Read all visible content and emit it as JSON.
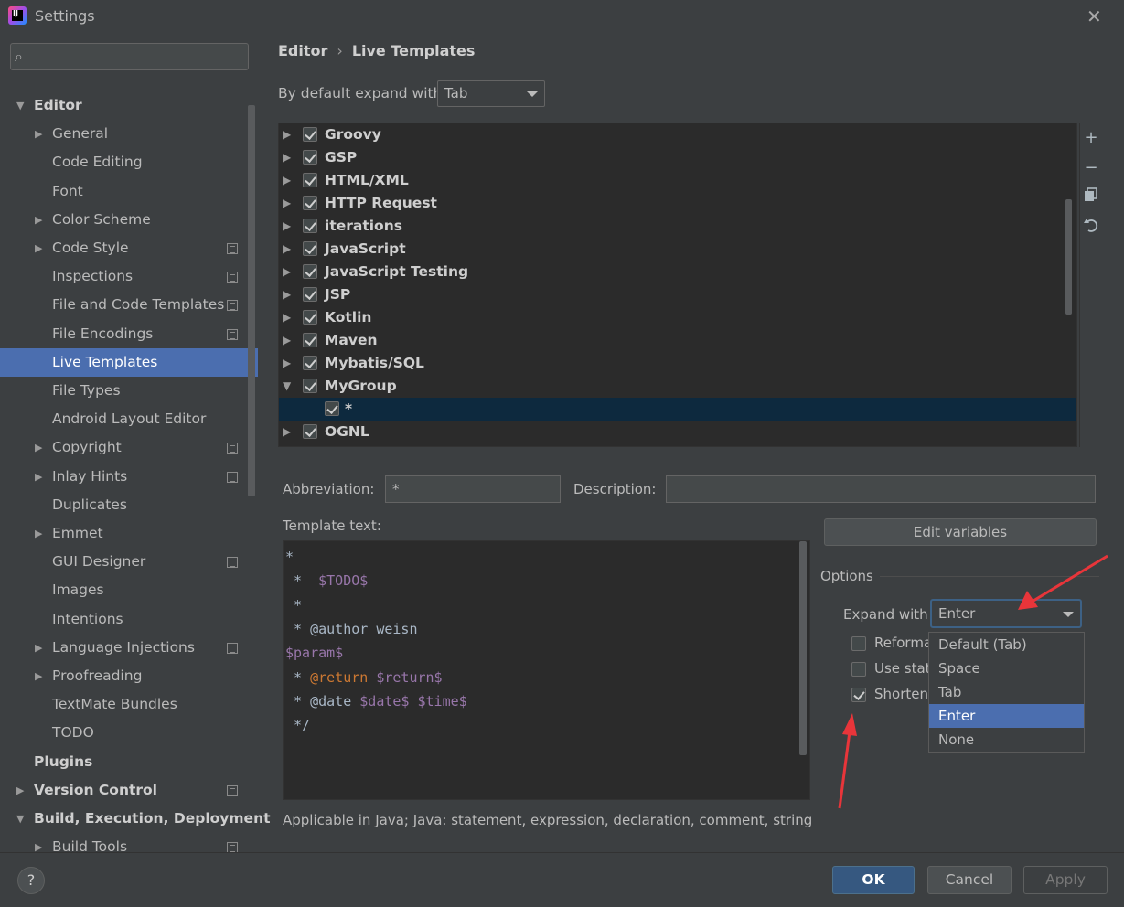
{
  "window": {
    "title": "Settings",
    "close_icon": "close-icon",
    "logo_letters": "IJ"
  },
  "sidebar": {
    "search": {
      "placeholder": "",
      "value": ""
    },
    "items": [
      {
        "label": "Editor",
        "bold": true,
        "expanded": true
      },
      {
        "label": "General",
        "expandable": true
      },
      {
        "label": "Code Editing"
      },
      {
        "label": "Font"
      },
      {
        "label": "Color Scheme",
        "expandable": true
      },
      {
        "label": "Code Style",
        "expandable": true,
        "page_icon": true
      },
      {
        "label": "Inspections",
        "page_icon": true
      },
      {
        "label": "File and Code Templates",
        "page_icon": true
      },
      {
        "label": "File Encodings",
        "page_icon": true
      },
      {
        "label": "Live Templates",
        "selected": true
      },
      {
        "label": "File Types"
      },
      {
        "label": "Android Layout Editor"
      },
      {
        "label": "Copyright",
        "expandable": true,
        "page_icon": true
      },
      {
        "label": "Inlay Hints",
        "expandable": true,
        "page_icon": true
      },
      {
        "label": "Duplicates"
      },
      {
        "label": "Emmet",
        "expandable": true
      },
      {
        "label": "GUI Designer",
        "page_icon": true
      },
      {
        "label": "Images"
      },
      {
        "label": "Intentions"
      },
      {
        "label": "Language Injections",
        "expandable": true,
        "page_icon": true
      },
      {
        "label": "Proofreading",
        "expandable": true
      },
      {
        "label": "TextMate Bundles"
      },
      {
        "label": "TODO"
      },
      {
        "label": "Plugins",
        "bold": true
      },
      {
        "label": "Version Control",
        "bold": true,
        "expandable": true,
        "page_icon": true
      },
      {
        "label": "Build, Execution, Deployment",
        "bold": true,
        "expanded": true
      },
      {
        "label": "Build Tools",
        "expandable": true,
        "page_icon": true
      }
    ]
  },
  "breadcrumb": {
    "parent": "Editor",
    "separator": "›",
    "current": "Live Templates"
  },
  "default_expand": {
    "label": "By default expand with",
    "value": "Tab"
  },
  "template_groups": [
    {
      "label": "Groovy",
      "checked": true,
      "expanded": false
    },
    {
      "label": "GSP",
      "checked": true,
      "expanded": false
    },
    {
      "label": "HTML/XML",
      "checked": true,
      "expanded": false
    },
    {
      "label": "HTTP Request",
      "checked": true,
      "expanded": false
    },
    {
      "label": "iterations",
      "checked": true,
      "expanded": false
    },
    {
      "label": "JavaScript",
      "checked": true,
      "expanded": false
    },
    {
      "label": "JavaScript Testing",
      "checked": true,
      "expanded": false
    },
    {
      "label": "JSP",
      "checked": true,
      "expanded": false
    },
    {
      "label": "Kotlin",
      "checked": true,
      "expanded": false
    },
    {
      "label": "Maven",
      "checked": true,
      "expanded": false
    },
    {
      "label": "Mybatis/SQL",
      "checked": true,
      "expanded": false
    },
    {
      "label": "MyGroup",
      "checked": true,
      "expanded": true,
      "children": [
        {
          "label": "*",
          "checked": true,
          "selected": true
        }
      ]
    },
    {
      "label": "OGNL",
      "checked": true,
      "expanded": false
    }
  ],
  "toolbar": {
    "add": "+",
    "remove": "−",
    "copy_icon": "copy-icon",
    "restore_icon": "restore-icon"
  },
  "abbreviation": {
    "label": "Abbreviation:",
    "value": "*"
  },
  "description": {
    "label": "Description:",
    "value": ""
  },
  "template_text": {
    "label": "Template text:",
    "lines": [
      [
        {
          "t": "*",
          "c": "plain"
        }
      ],
      [
        {
          "t": " *  ",
          "c": "plain"
        },
        {
          "t": "$TODO$",
          "c": "var"
        }
      ],
      [
        {
          "t": " *",
          "c": "plain"
        }
      ],
      [
        {
          "t": " * @author weisn",
          "c": "plain"
        }
      ],
      [
        {
          "t": "$param$",
          "c": "var"
        }
      ],
      [
        {
          "t": " * ",
          "c": "plain"
        },
        {
          "t": "@return",
          "c": "kw"
        },
        {
          "t": " ",
          "c": "plain"
        },
        {
          "t": "$return$",
          "c": "var"
        }
      ],
      [
        {
          "t": " * @date ",
          "c": "plain"
        },
        {
          "t": "$date$",
          "c": "var"
        },
        {
          "t": " ",
          "c": "plain"
        },
        {
          "t": "$time$",
          "c": "var"
        }
      ],
      [
        {
          "t": " */",
          "c": "plain"
        }
      ]
    ]
  },
  "edit_variables_label": "Edit variables",
  "options": {
    "title": "Options",
    "expand_with_label": "Expand with",
    "expand_with_value": "Enter",
    "checkboxes": [
      {
        "label": "Reforma",
        "checked": false
      },
      {
        "label": "Use stat",
        "checked": false
      },
      {
        "label": "Shorten",
        "checked": true
      }
    ],
    "dropdown_options": [
      {
        "label": "Default (Tab)",
        "active": false
      },
      {
        "label": "Space",
        "active": false
      },
      {
        "label": "Tab",
        "active": false
      },
      {
        "label": "Enter",
        "active": true
      },
      {
        "label": "None",
        "active": false
      }
    ]
  },
  "applicable_text": "Applicable in Java; Java: statement, expression, declaration, comment, string, sm",
  "footer": {
    "help_label": "?",
    "ok_label": "OK",
    "cancel_label": "Cancel",
    "apply_label": "Apply"
  },
  "colors": {
    "background": "#3c3f41",
    "selection": "#4b6eaf",
    "tree_selection": "#0d293e",
    "annotation_arrow": "#e8353a"
  }
}
